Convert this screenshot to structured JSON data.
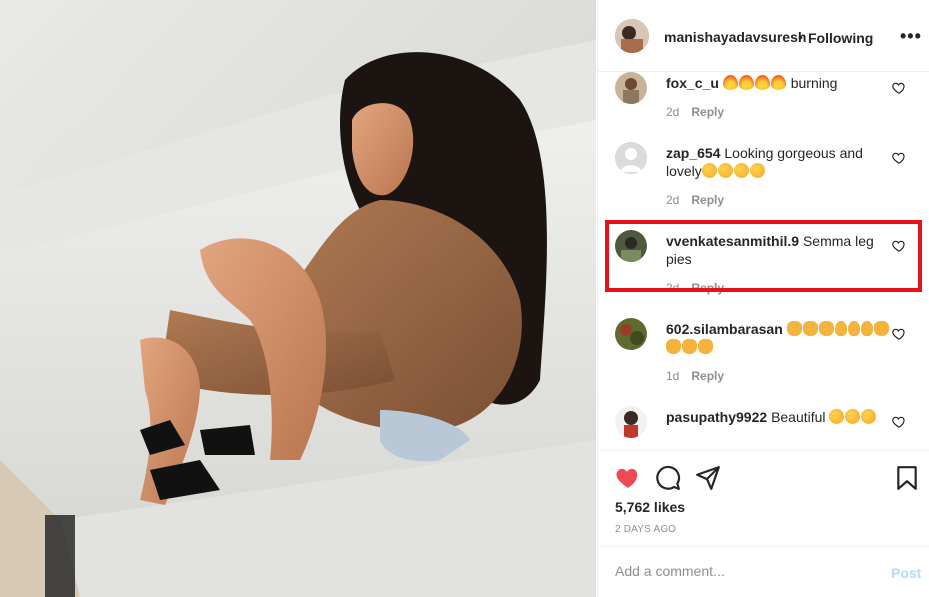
{
  "post": {
    "username": "manishayadavsuresh",
    "separator": "•",
    "follow_status": "Following",
    "more_label": "•••"
  },
  "comments": [
    {
      "user": "fox_c_u",
      "text": "burning",
      "emojis": [
        "fire",
        "fire",
        "fire",
        "fire"
      ],
      "emojis_after": false,
      "age": "2d",
      "reply": "Reply"
    },
    {
      "user": "zap_654",
      "text": "Looking gorgeous and lovely",
      "trailing_emojis": [
        "face",
        "face",
        "face",
        "face"
      ],
      "age": "2d",
      "reply": "Reply"
    },
    {
      "user": "vvenkatesanmithil.9",
      "text": "Semma leg pies",
      "age": "2d",
      "reply": "Reply"
    },
    {
      "user": "602.silambarasan",
      "emojis": [
        "hand",
        "hand",
        "hand",
        "ok",
        "ok",
        "ok",
        "hand",
        "hand",
        "hand",
        "hand"
      ],
      "age": "1d",
      "reply": "Reply"
    },
    {
      "user": "pasupathy9922",
      "text": "Beautiful",
      "trailing_emojis": [
        "heart-eyes",
        "heart-eyes",
        "heart-eyes"
      ]
    }
  ],
  "actions": {
    "likes": "5,762 likes",
    "time": "2 DAYS AGO",
    "comment_placeholder": "Add a comment...",
    "post_label": "Post"
  },
  "colors": {
    "like_red": "#ed4956",
    "highlight_red": "#e8111a",
    "post_disabled": "#b3dbff"
  }
}
